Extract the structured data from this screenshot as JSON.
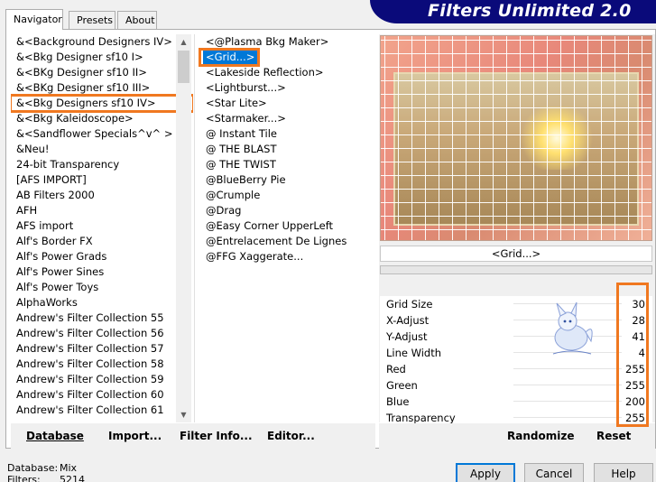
{
  "tabs": [
    "Navigator",
    "Presets",
    "About"
  ],
  "banner_title": "Filters Unlimited 2.0",
  "categories": [
    "&<Background Designers IV>",
    "&<Bkg Designer sf10 I>",
    "&<BKg Designer sf10 II>",
    "&<BKg Designer sf10 III>",
    "&<Bkg Designers sf10 IV>",
    "&<Bkg Kaleidoscope>",
    "&<Sandflower Specials^v^ >",
    "&Neu!",
    "24-bit Transparency",
    "[AFS IMPORT]",
    "AB Filters 2000",
    "AFH",
    "AFS import",
    "Alf's Border FX",
    "Alf's Power Grads",
    "Alf's Power Sines",
    "Alf's Power Toys",
    "AlphaWorks",
    "Andrew's Filter Collection 55",
    "Andrew's Filter Collection 56",
    "Andrew's Filter Collection 57",
    "Andrew's Filter Collection 58",
    "Andrew's Filter Collection 59",
    "Andrew's Filter Collection 60",
    "Andrew's Filter Collection 61"
  ],
  "selected_category_index": 4,
  "filters": [
    "<@Plasma Bkg Maker>",
    "<Grid...>",
    "<Lakeside Reflection>",
    "<Lightburst...>",
    "<Star Lite>",
    "<Starmaker...>",
    "@ Instant Tile",
    "@ THE BLAST",
    "@ THE TWIST",
    "@BlueBerry Pie",
    "@Crumple",
    "@Drag",
    "@Easy Corner UpperLeft",
    "@Entrelacement De Lignes",
    "@FFG Xaggerate..."
  ],
  "selected_filter_index": 1,
  "current_filter_label": "<Grid...>",
  "params": [
    {
      "name": "Grid Size",
      "value": "30"
    },
    {
      "name": "X-Adjust",
      "value": "28"
    },
    {
      "name": "Y-Adjust",
      "value": "41"
    },
    {
      "name": "Line Width",
      "value": "4"
    },
    {
      "name": "Red",
      "value": "255"
    },
    {
      "name": "Green",
      "value": "255"
    },
    {
      "name": "Blue",
      "value": "200"
    },
    {
      "name": "Transparency",
      "value": "255"
    }
  ],
  "toolbar": {
    "database": "Database",
    "import": "Import...",
    "filter_info": "Filter Info...",
    "editor": "Editor...",
    "randomize": "Randomize",
    "reset": "Reset"
  },
  "status": {
    "database_label": "Database:",
    "database_value": "Mix",
    "filters_label": "Filters:",
    "filters_value": "5214"
  },
  "buttons": {
    "apply": "Apply",
    "cancel": "Cancel",
    "help": "Help"
  },
  "colors": {
    "banner": "#0a0a7a",
    "highlight": "#f07820",
    "selection": "#0078d7"
  }
}
